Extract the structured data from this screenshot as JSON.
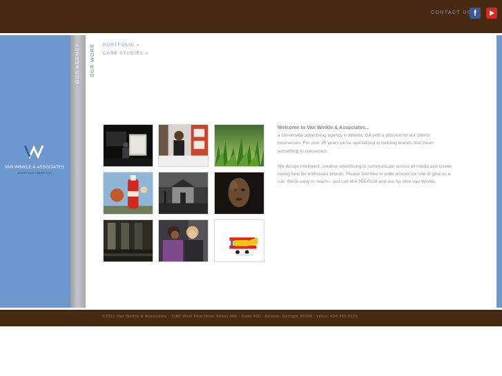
{
  "header": {
    "contact_label": "CONTACT US",
    "facebook_label": "f"
  },
  "brand": {
    "name": "VAN WINKLE & ASSOCIATES",
    "tagline": "ADVERTISING | MARKETING"
  },
  "sidebar": {
    "agency_label": "OUR AGENCY",
    "work_label": "OUR WORK"
  },
  "subnav": {
    "items": [
      {
        "label": "PORTFOLIO »"
      },
      {
        "label": "CASE STUDIES »"
      }
    ]
  },
  "gallery": {
    "thumbnails": [
      {
        "name": "dark-presentation-scene"
      },
      {
        "name": "woman-in-office"
      },
      {
        "name": "green-grass-field"
      },
      {
        "name": "ketchup-bottle-mascots"
      },
      {
        "name": "old-house-dusk"
      },
      {
        "name": "carved-face-sculpture"
      },
      {
        "name": "dark-room-windows"
      },
      {
        "name": "two-women-laughing"
      },
      {
        "name": "toy-biplane"
      }
    ]
  },
  "intro": {
    "heading": "Welcome to Van Winkle & Associates...",
    "paragraph1_rest": "a full-service advertising agency in Atlanta, GA with a passion for our clients' businesses. For over 25 years we've specialized in building brands that mean something to consumers.",
    "paragraph2": "We design intelligent, creative advertising to communicate across all media and create raving fans for enthusiast brands. Please feel free to poke around our site or give us a call. We're easy to reach— just call 404.355.0126 and ask for Alex Van Winkle."
  },
  "footer": {
    "text": "©2011 Van Winkle & Associates · 1180 West Peachtree Street NW · Suite 400 · Atlanta, Georgia 30309 · voice: 404.355.0126"
  },
  "colors": {
    "header_brown": "#472a12",
    "brand_blue": "#6c98cd",
    "link_blue": "#3f78b2",
    "body_gray": "#9a9a9a"
  }
}
